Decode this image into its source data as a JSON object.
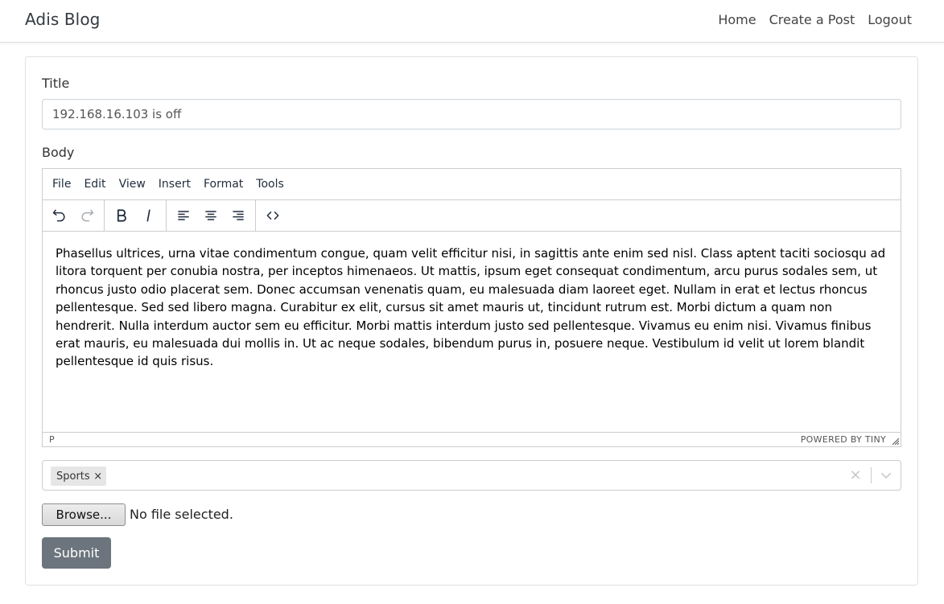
{
  "navbar": {
    "brand": "Adis Blog",
    "links": [
      "Home",
      "Create a Post",
      "Logout"
    ]
  },
  "form": {
    "title_label": "Title",
    "title_value": "192.168.16.103 is off",
    "body_label": "Body"
  },
  "editor": {
    "menu": [
      "File",
      "Edit",
      "View",
      "Insert",
      "Format",
      "Tools"
    ],
    "toolbar_icons": [
      "undo-icon",
      "redo-icon",
      "bold-icon",
      "italic-icon",
      "align-left-icon",
      "align-center-icon",
      "align-right-icon",
      "code-icon"
    ],
    "content": "Phasellus ultrices, urna vitae condimentum congue, quam velit efficitur nisi, in sagittis ante enim sed nisl. Class aptent taciti sociosqu ad litora torquent per conubia nostra, per inceptos himenaeos. Ut mattis, ipsum eget consequat condimentum, arcu purus sodales sem, ut rhoncus justo odio placerat sem. Donec accumsan venenatis quam, eu malesuada diam laoreet eget. Nullam in erat et lectus rhoncus pellentesque. Sed sed libero magna. Curabitur ex elit, cursus sit amet mauris ut, tincidunt rutrum est. Morbi dictum a quam non hendrerit. Nulla interdum auctor sem eu efficitur. Morbi mattis interdum justo sed pellentesque. Vivamus eu enim nisi. Vivamus finibus erat mauris, eu malesuada dui mollis in. Ut ac neque sodales, bibendum purus in, posuere neque. Vestibulum id velit ut lorem blandit pellentesque id quis risus.",
    "status_path": "P",
    "powered_by": "POWERED BY TINY"
  },
  "tags": {
    "selected": [
      "Sports"
    ],
    "remove_glyph": "×",
    "clear_glyph": "×"
  },
  "file": {
    "browse_label": "Browse...",
    "status": "No file selected."
  },
  "submit_label": "Submit",
  "colors": {
    "submit_bg": "#6c757d",
    "chip_bg": "#e6e6e6",
    "border": "#ced4da"
  }
}
